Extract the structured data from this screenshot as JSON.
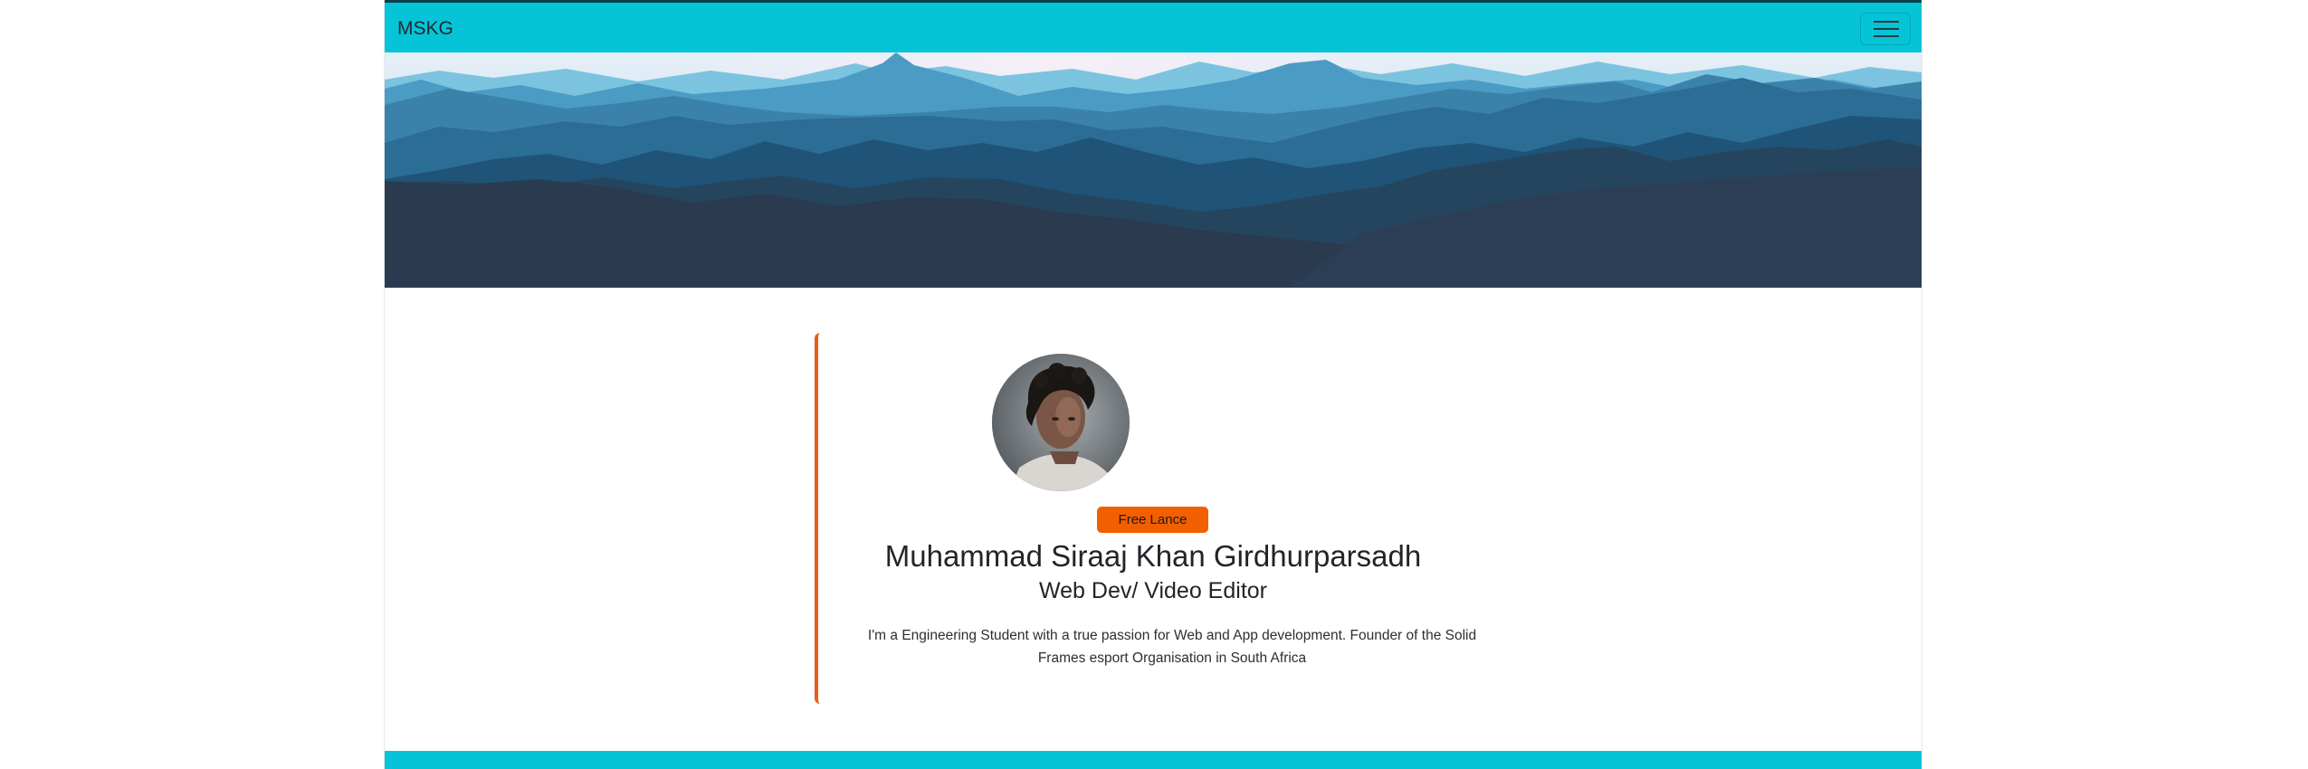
{
  "navbar": {
    "brand": "MSKG",
    "toggle_icon": "hamburger-menu-icon"
  },
  "hero": {
    "image": "mountain-landscape-banner",
    "colors": [
      "#5fb3d6",
      "#3e8db5",
      "#28698f",
      "#1f4f74",
      "#2c3e55"
    ]
  },
  "profile": {
    "avatar": "profile-photo",
    "badge": "Free Lance",
    "name": "Muhammad Siraaj Khan Girdhurparsadh",
    "role": "Web Dev/ Video Editor",
    "bio": "I'm a Engineering Student with a true passion for Web and App development. Founder of the Solid Frames esport Organisation in South Africa"
  },
  "colors": {
    "primary": "#05c4d8",
    "accent": "#f25f00"
  }
}
